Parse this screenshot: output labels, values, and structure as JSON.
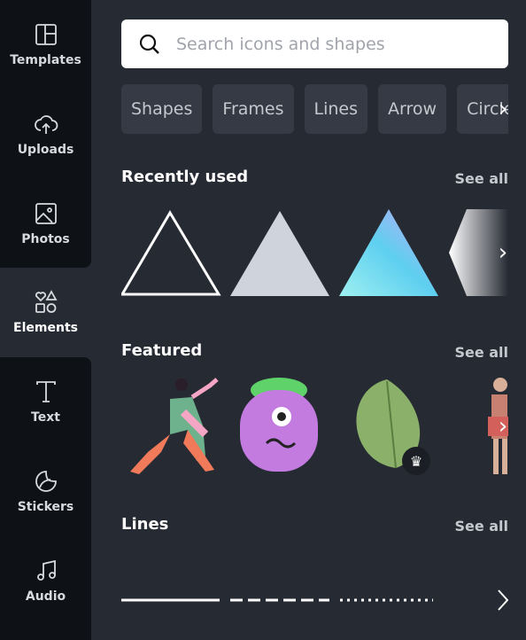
{
  "sidebar": {
    "items": [
      {
        "label": "Templates",
        "icon": "template-icon"
      },
      {
        "label": "Uploads",
        "icon": "cloud-upload-icon"
      },
      {
        "label": "Photos",
        "icon": "image-icon"
      },
      {
        "label": "Elements",
        "icon": "shapes-icon",
        "active": true
      },
      {
        "label": "Text",
        "icon": "text-icon"
      },
      {
        "label": "Stickers",
        "icon": "sticker-icon"
      },
      {
        "label": "Audio",
        "icon": "music-note-icon"
      }
    ]
  },
  "search": {
    "placeholder": "Search icons and shapes"
  },
  "chips": [
    "Shapes",
    "Frames",
    "Lines",
    "Arrow",
    "Circle"
  ],
  "sections": {
    "recent": {
      "title": "Recently used",
      "see_all": "See all"
    },
    "featured": {
      "title": "Featured",
      "see_all": "See all"
    },
    "lines": {
      "title": "Lines",
      "see_all": "See all"
    }
  },
  "colors": {
    "sidebar": "#0e1116",
    "panel": "#262a33",
    "chip": "#353a44"
  }
}
